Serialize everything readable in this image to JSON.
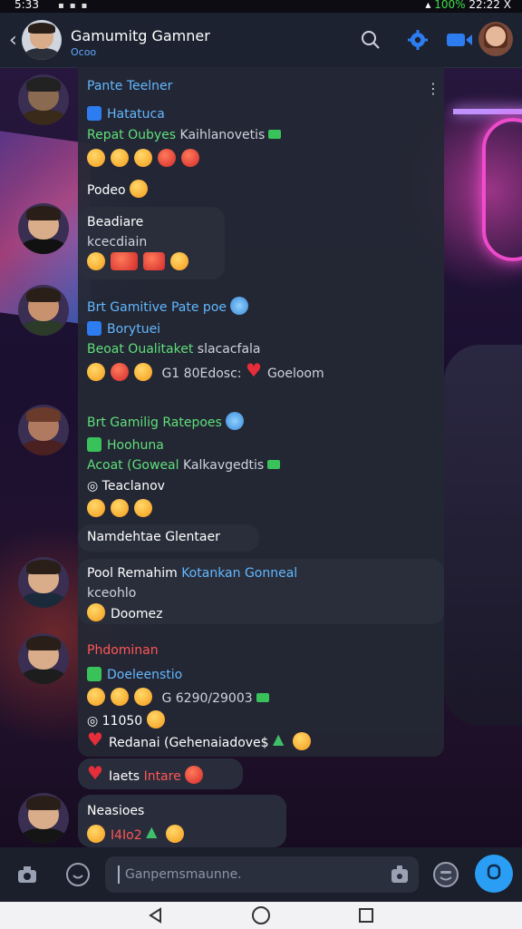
{
  "status_bar": {
    "time": "5:33",
    "battery": "100%",
    "clock": "22:22",
    "close": "X"
  },
  "header": {
    "back_icon": "back-arrow-icon",
    "title": "Gamumitg Gamner",
    "subtitle": "Ocoo",
    "icons": [
      "search-icon",
      "gear-icon",
      "video-camera-icon"
    ],
    "accent": "#2d7cf0"
  },
  "messages": [
    {
      "sender": "Pante Teelner",
      "sender_color": "#62b8ff",
      "lines": [
        {
          "icon": "blue-square-icon",
          "text": "Hatatuca",
          "color": "#62b8ff"
        },
        {
          "text": "Repat Oubyes",
          "color": "#5fe07a",
          "extra": "Kaihlanovetis"
        },
        {
          "reactions": [
            "emoji",
            "emoji",
            "emoji",
            "emoji",
            "emoji"
          ]
        },
        {
          "text": "Podeo",
          "color": "#ffffff"
        }
      ]
    },
    {
      "sender": "Beadiare",
      "sender_color": "#ffffff",
      "lines": [
        {
          "text": "kcecdiain",
          "color": "#cfd3dc"
        },
        {
          "reactions": [
            "emoji",
            "emoji-red",
            "emoji-red",
            "emoji"
          ]
        }
      ]
    },
    {
      "sender": "Brt Gamitive Pate poe",
      "sender_color": "#62b8ff",
      "lines": [
        {
          "icon": "blue-square-icon",
          "text": "Borytuei",
          "color": "#62b8ff"
        },
        {
          "text": "Beoat Oualitaket",
          "color": "#5fe07a",
          "extra": "slacacfala"
        },
        {
          "reactions": [
            "emoji",
            "emoji-red",
            "emoji"
          ],
          "text": "G1 80Edosc:",
          "extra": "Goeloom"
        }
      ]
    },
    {
      "sender": "Brt Gamilig Ratepoes",
      "sender_color": "#5fe07a",
      "lines": [
        {
          "icon": "green-check-icon",
          "text": "Hoohuna",
          "color": "#5fe07a"
        },
        {
          "text": "Acoat (Goweal",
          "color": "#5fe07a",
          "extra": "Kalkavgedtis"
        },
        {
          "icon": "clock-icon",
          "text": "Teaclanov",
          "color": "#ffffff"
        },
        {
          "reactions": [
            "emoji",
            "emoji",
            "emoji"
          ]
        },
        {
          "text": "Namdehtae Glentaer",
          "color": "#ffffff"
        }
      ]
    },
    {
      "sender": "Pool Remahim",
      "sender_color": "#ffffff",
      "sender_extra": "Kotankan Gonneal",
      "lines": [
        {
          "text": "kceohlo",
          "color": "#cfd3dc"
        },
        {
          "text": "Doomez",
          "color": "#ffffff"
        }
      ]
    },
    {
      "sender": "Phdominan",
      "sender_color": "#ff5656",
      "lines": [
        {
          "icon": "green-check-icon",
          "text": "Doeleenstio",
          "color": "#62b8ff"
        },
        {
          "reactions": [
            "emoji",
            "emoji",
            "emoji"
          ],
          "text": "G 6290/29003"
        },
        {
          "icon": "clock-icon",
          "text": "11050",
          "color": "#ffffff"
        },
        {
          "icon": "heart-icon",
          "text": "Redanai",
          "color": "#ffffff",
          "extra": "(Gehenaiadove$"
        }
      ]
    },
    {
      "sender": "",
      "lines": [
        {
          "icon": "heart-icon",
          "text": "Iaets",
          "color": "#ffffff",
          "extra": "Intare"
        }
      ]
    },
    {
      "sender": "Neasioes",
      "sender_color": "#ffffff",
      "lines": [
        {
          "reactions": [
            "emoji"
          ],
          "text": "I4Io2",
          "color": "#ff5656"
        }
      ]
    }
  ],
  "composer": {
    "placeholder": "Ganpemsmaunne.",
    "icons": [
      "camera-icon",
      "chat-bubble-icon",
      "attachment-icon",
      "emoji-icon",
      "send-icon"
    ]
  },
  "navbar": {
    "icons": [
      "back-triangle-icon",
      "home-circle-icon",
      "recents-square-icon"
    ]
  }
}
